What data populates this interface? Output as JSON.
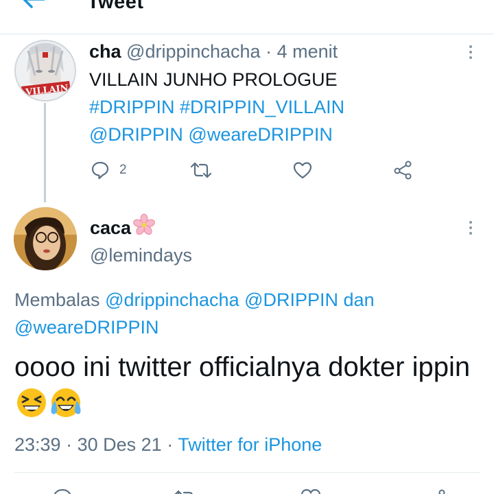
{
  "header": {
    "back_icon": "arrow-left-icon",
    "title": "Tweet"
  },
  "colors": {
    "link": "#1b95e0",
    "muted": "#5b7083",
    "text": "#0f1419",
    "divider": "#e1e8ed"
  },
  "parent_tweet": {
    "display_name": "cha",
    "handle": "@drippinchacha",
    "separator": "·",
    "time": "4 menit",
    "text": "VILLAIN JUNHO PROLOGUE",
    "hashtags": "#DRIPPIN #DRIPPIN_VILLAIN",
    "mentions": "@DRIPPIN @weareDRIPPIN",
    "avatar_caption": "VILLAIN",
    "actions": {
      "reply_icon": "comment-icon",
      "reply_count": "2",
      "retweet_icon": "retweet-icon",
      "like_icon": "heart-icon",
      "share_icon": "share-icon"
    },
    "more_icon": "more-vertical-icon"
  },
  "main_tweet": {
    "display_name": "caca",
    "name_emoji": "cherry-blossom-icon",
    "handle": "@lemindays",
    "reply_prefix": "Membalas",
    "reply_users": "@drippinchacha @DRIPPIN",
    "reply_and": "dan",
    "reply_last": "@weareDRIPPIN",
    "text": "oooo ini twitter officialnya dokter ippin",
    "emojis": [
      "grinning-squinting-face-icon",
      "face-with-tears-of-joy-icon"
    ],
    "time": "23:39",
    "separator": "·",
    "date": "30 Des 21",
    "separator2": "·",
    "client": "Twitter for iPhone",
    "more_icon": "more-vertical-icon"
  }
}
